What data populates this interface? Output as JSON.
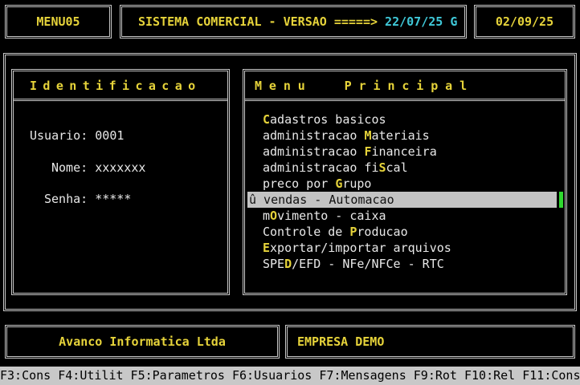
{
  "header": {
    "menu_id": "MENU05",
    "system_title": "SISTEMA COMERCIAL - VERSAO =====>",
    "version": "22/07/25 G",
    "date": "02/09/25"
  },
  "ident": {
    "title": "Identificacao",
    "usuario_label": "Usuario:",
    "usuario_value": "0001",
    "nome_label": "Nome:",
    "nome_value": "xxxxxxx",
    "senha_label": "Senha:",
    "senha_value": "*****"
  },
  "menu": {
    "title": "Menu Principal",
    "items": [
      {
        "pre": "",
        "key": "C",
        "post": "adastros basicos"
      },
      {
        "pre": "administracao ",
        "key": "M",
        "post": "ateriais"
      },
      {
        "pre": "administracao ",
        "key": "F",
        "post": "inanceira"
      },
      {
        "pre": "administracao fi",
        "key": "S",
        "post": "cal"
      },
      {
        "pre": "preco por ",
        "key": "G",
        "post": "rupo"
      },
      {
        "pre": "",
        "key": "",
        "post": "û vendas - Automacao"
      },
      {
        "pre": "m",
        "key": "O",
        "post": "vimento - caixa"
      },
      {
        "pre": "Controle de ",
        "key": "P",
        "post": "roducao"
      },
      {
        "pre": "",
        "key": "E",
        "post": "xportar/importar arquivos"
      },
      {
        "pre": "SPE",
        "key": "D",
        "post": "/EFD - NFe/NFCe - RTC"
      }
    ],
    "selected_index": 5
  },
  "footer": {
    "company": "Avanco Informatica Ltda",
    "empresa": "EMPRESA DEMO"
  },
  "fkeys": [
    "F3:Cons",
    "F4:Utilit",
    "F5:Parametros",
    "F6:Usuarios",
    "F7:Mensagens",
    "F9:Rot",
    "F10:Rel",
    "F11:Cons"
  ],
  "colors": {
    "highlight_yellow": "#e6d33a",
    "version_cyan": "#3fc8d8",
    "selection_bg": "#c3c3c3",
    "cursor_green": "#2ed82e"
  }
}
